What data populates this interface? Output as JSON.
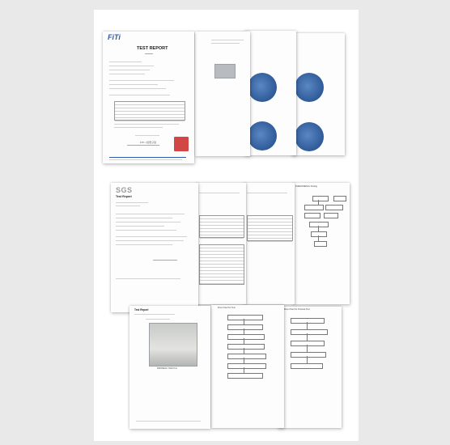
{
  "fiti": {
    "logo": "FiTi",
    "title": "TEST REPORT",
    "footer": "FITI 시험연구원"
  },
  "sgs": {
    "logo": "SGS",
    "report_label": "Test Report",
    "flow_title": "PHENOMENAL Testing",
    "photo_caption": "BIRDBEAK SWATCH",
    "flowchart_title": "Flow Chart for Test",
    "flowchart_title_2": "Flow Chart for Pretreat Test"
  },
  "colors": {
    "fiti_blue": "#2d5aa5",
    "stamp_red": "#d24646",
    "dish_blue": "#2e5a98",
    "background": "#e9e9e9"
  }
}
